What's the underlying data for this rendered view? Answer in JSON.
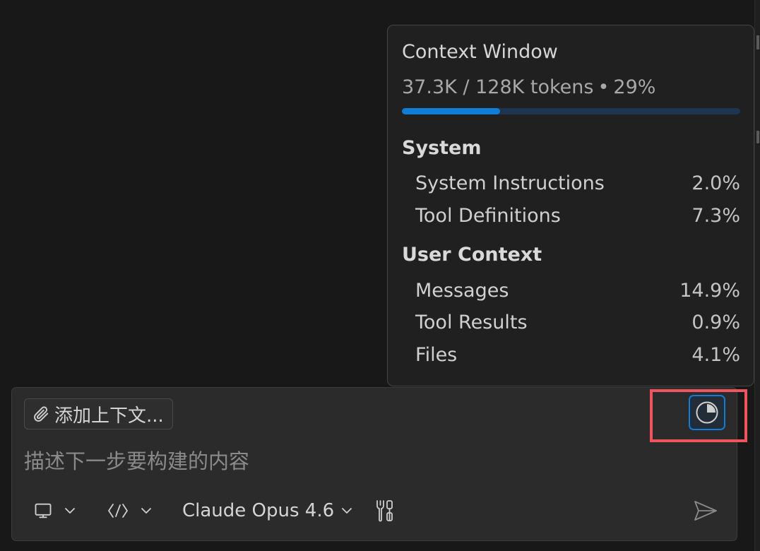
{
  "context_window": {
    "title": "Context Window",
    "usage_text": "37.3K / 128K tokens",
    "separator": "•",
    "percent_text": "29%",
    "progress_fraction": 0.29,
    "sections": [
      {
        "label": "System",
        "items": [
          {
            "label": "System Instructions",
            "value": "2.0%"
          },
          {
            "label": "Tool Definitions",
            "value": "7.3%"
          }
        ]
      },
      {
        "label": "User Context",
        "items": [
          {
            "label": "Messages",
            "value": "14.9%"
          },
          {
            "label": "Tool Results",
            "value": "0.9%"
          },
          {
            "label": "Files",
            "value": "4.1%"
          }
        ]
      }
    ]
  },
  "chat": {
    "add_context_label": "添加上下文...",
    "input_placeholder": "描述下一步要构建的内容",
    "model_label": "Claude Opus 4.6"
  },
  "icons": {
    "attach": "paperclip-icon",
    "usage": "pie-chart-icon",
    "target": "monitor-icon",
    "mode": "code-brackets-icon",
    "tools": "tools-icon",
    "send": "send-icon"
  },
  "colors": {
    "accent": "#0f7cd8",
    "progress_track": "#1d3550",
    "highlight": "#f0555e",
    "popup_bg": "#202020",
    "panel_bg": "#2b2b2b"
  }
}
